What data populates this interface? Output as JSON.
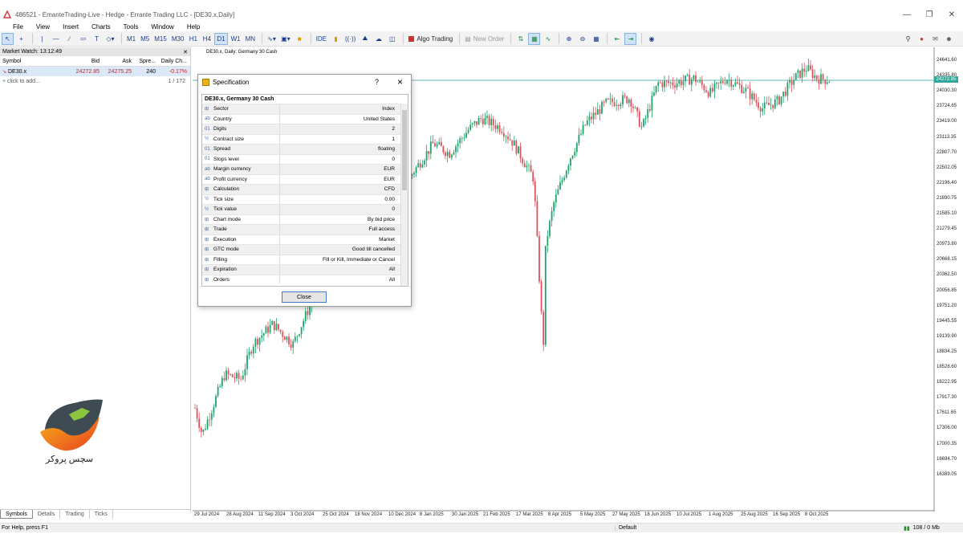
{
  "window": {
    "title": "486521 - EmanteTrading-Live - Hedge - Errante Trading LLC - [DE30.x,Daily]"
  },
  "menu": [
    "File",
    "View",
    "Insert",
    "Charts",
    "Tools",
    "Window",
    "Help"
  ],
  "toolbar": {
    "timeframes": [
      "M1",
      "M5",
      "M15",
      "M30",
      "H1",
      "H4",
      "D1",
      "W1",
      "MN"
    ],
    "selected_timeframe": "D1",
    "ide_label": "IDE",
    "algo_label": "Algo Trading",
    "new_order_label": "New Order"
  },
  "market_watch": {
    "title": "Market Watch: 13:12:49",
    "columns": [
      "Symbol",
      "Bid",
      "Ask",
      "Spre...",
      "Daily Ch..."
    ],
    "rows": [
      {
        "symbol": "DE30.x",
        "bid": "24272.85",
        "ask": "24275.25",
        "spread": "240",
        "change": "-0.17%"
      }
    ],
    "add_label": "click to add...",
    "count": "1 / 172",
    "tabs": [
      "Symbols",
      "Details",
      "Trading",
      "Ticks"
    ]
  },
  "chart": {
    "label": "DE30.x, Daily:  Germany 30 Cash",
    "current_price": "24272.85",
    "price_levels": [
      "24641.60",
      "24335.80",
      "24030.30",
      "23724.65",
      "23419.00",
      "23113.35",
      "22807.70",
      "22502.05",
      "22196.40",
      "21890.75",
      "21585.10",
      "21279.45",
      "20973.80",
      "20668.15",
      "20362.50",
      "20056.85",
      "19751.20",
      "19445.55",
      "19139.90",
      "18834.25",
      "18528.60",
      "18222.95",
      "17917.30",
      "17611.65",
      "17306.00",
      "17000.35",
      "16694.70",
      "16389.05"
    ],
    "dates": [
      "29 Jul 2024",
      "28 Aug 2024",
      "11 Sep 2024",
      "3 Oct 2024",
      "25 Oct 2024",
      "18 Nov 2024",
      "10 Dec 2024",
      "8 Jan 2025",
      "30 Jan 2025",
      "21 Feb 2025",
      "17 Mar 2025",
      "8 Apr 2025",
      "5 May 2025",
      "27 May 2025",
      "18 Jun 2025",
      "10 Jul 2025",
      "1 Aug 2025",
      "25 Aug 2025",
      "16 Sep 2025",
      "8 Oct 2025"
    ],
    "up_color": "#1fa36b",
    "down_color": "#e0505a"
  },
  "dialog": {
    "title": "Specification",
    "help": "?",
    "heading": "DE30.x, Germany 30 Cash",
    "rows": [
      {
        "icon": "⊞",
        "key": "Sector",
        "value": "Index"
      },
      {
        "icon": "ab",
        "key": "Country",
        "value": "United States"
      },
      {
        "icon": "01",
        "key": "Digits",
        "value": "2"
      },
      {
        "icon": "½",
        "key": "Contract size",
        "value": "1"
      },
      {
        "icon": "01",
        "key": "Spread",
        "value": "floating"
      },
      {
        "icon": "01",
        "key": "Stops level",
        "value": "0"
      },
      {
        "icon": "ab",
        "key": "Margin currency",
        "value": "EUR"
      },
      {
        "icon": "ab",
        "key": "Profit currency",
        "value": "EUR"
      },
      {
        "icon": "⊞",
        "key": "Calculation",
        "value": "CFD"
      },
      {
        "icon": "½",
        "key": "Tick size",
        "value": "0.00"
      },
      {
        "icon": "½",
        "key": "Tick value",
        "value": "0"
      },
      {
        "icon": "⊞",
        "key": "Chart mode",
        "value": "By bid price"
      },
      {
        "icon": "⊞",
        "key": "Trade",
        "value": "Full access"
      },
      {
        "icon": "⊞",
        "key": "Execution",
        "value": "Market"
      },
      {
        "icon": "⊞",
        "key": "GTC mode",
        "value": "Good till cancelled"
      },
      {
        "icon": "⊞",
        "key": "Filling",
        "value": "Fill or Kill, Immediate or Cancel"
      },
      {
        "icon": "⊞",
        "key": "Expiration",
        "value": "All"
      },
      {
        "icon": "⊞",
        "key": "Orders",
        "value": "All"
      }
    ],
    "close_label": "Close"
  },
  "logo": {
    "text": "سچس پروکر"
  },
  "status": {
    "help": "For Help, press F1",
    "profile": "Default",
    "memory": "108 / 0 Mb"
  }
}
